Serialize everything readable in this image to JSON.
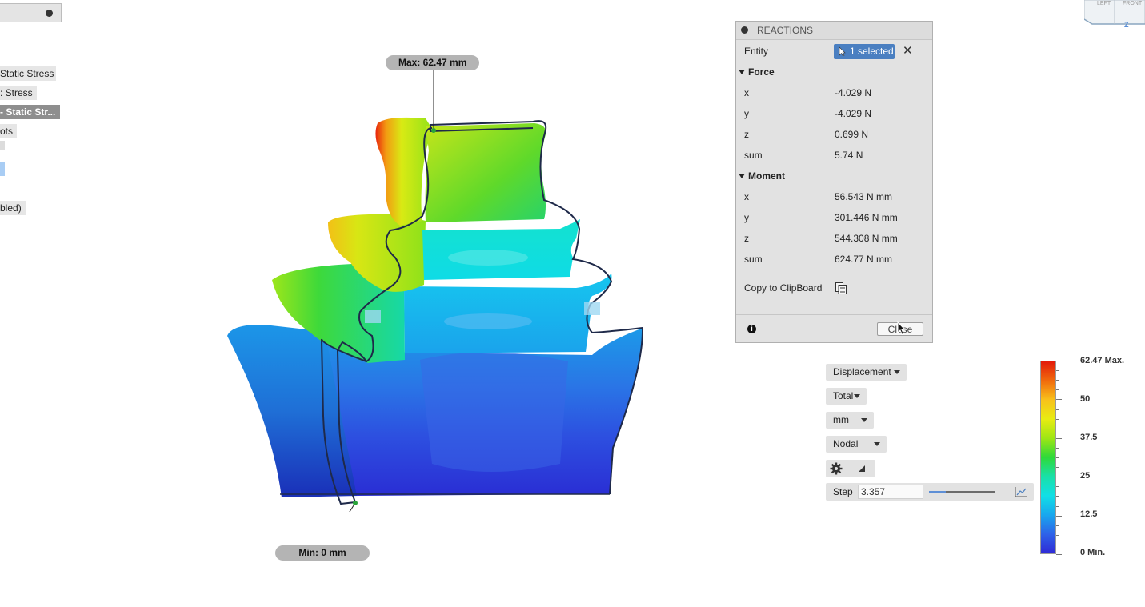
{
  "browser": {
    "items": [
      {
        "label": "Static Stress"
      },
      {
        "label": ": Stress"
      },
      {
        "label": "- Static Str..."
      },
      {
        "label": "ots"
      },
      {
        "label": "bled)"
      }
    ]
  },
  "probes": {
    "max_label": "Max: 62.47 mm",
    "min_label": "Min: 0 mm"
  },
  "reactions": {
    "title": "REACTIONS",
    "entity_label": "Entity",
    "entity_value": "1 selected",
    "force": {
      "header": "Force",
      "rows": [
        {
          "label": "x",
          "value": "-4.029 N"
        },
        {
          "label": "y",
          "value": "-4.029 N"
        },
        {
          "label": "z",
          "value": "0.699 N"
        },
        {
          "label": "sum",
          "value": "5.74 N"
        }
      ]
    },
    "moment": {
      "header": "Moment",
      "rows": [
        {
          "label": "x",
          "value": "56.543 N mm"
        },
        {
          "label": "y",
          "value": "301.446 N mm"
        },
        {
          "label": "z",
          "value": "544.308 N mm"
        },
        {
          "label": "sum",
          "value": "624.77 N mm"
        }
      ]
    },
    "copy_label": "Copy to ClipBoard",
    "close_label": "Close"
  },
  "result_controls": {
    "result_type": "Displacement",
    "component": "Total",
    "units": "mm",
    "display": "Nodal",
    "step_label": "Step",
    "step_value": "3.357",
    "step_slider_fraction": 0.25
  },
  "legend": {
    "labels": [
      {
        "text": "62.47 Max."
      },
      {
        "text": "50"
      },
      {
        "text": "37.5"
      },
      {
        "text": "25"
      },
      {
        "text": "12.5"
      },
      {
        "text": "0 Min."
      }
    ],
    "max": 62.47,
    "min": 0,
    "colors": [
      "#e31a0a",
      "#f8c11b",
      "#e8ec12",
      "#2ed93a",
      "#11dfe6",
      "#2e62e8",
      "#2f2ad6"
    ]
  },
  "icons": {
    "cursor": "pointer-arrow-icon",
    "gear": "gear-icon",
    "clipboard": "clipboard-icon",
    "info": "info-icon",
    "graph": "graph-icon"
  }
}
